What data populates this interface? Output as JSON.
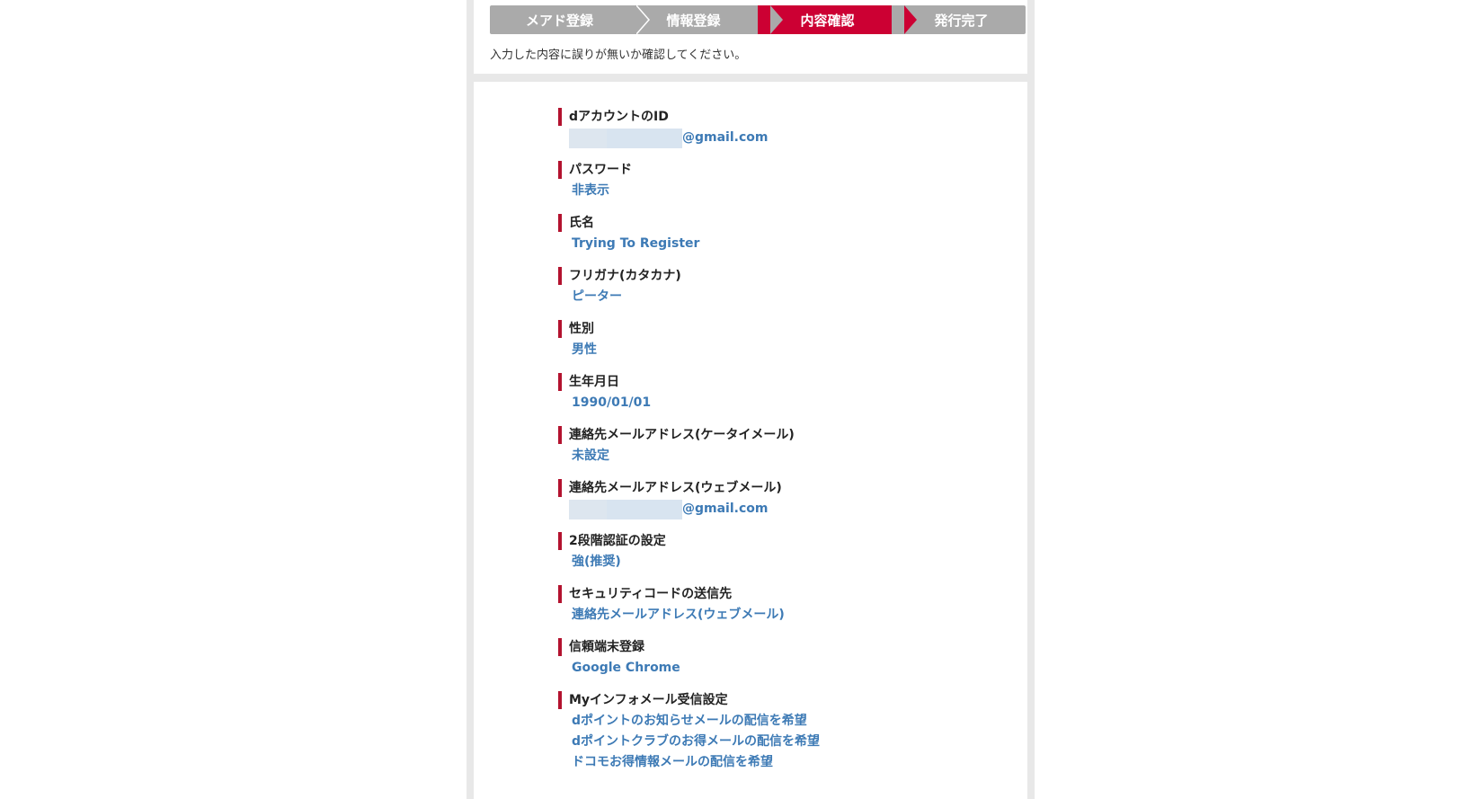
{
  "steps": [
    {
      "label": "メアド登録",
      "state": "done"
    },
    {
      "label": "情報登録",
      "state": "done"
    },
    {
      "label": "内容確認",
      "state": "active"
    },
    {
      "label": "発行完了",
      "state": "pending"
    }
  ],
  "intro_text": "入力した内容に誤りが無いか確認してください。",
  "colors": {
    "step_inactive": "#aaaaaa",
    "step_active": "#cc0033",
    "label_bar": "#b3132f",
    "value_text": "#3d7ab5",
    "mask": "#d8e4f0"
  },
  "items": [
    {
      "label": "dアカウントのID",
      "values": [
        "@gmail.com"
      ],
      "masked": true
    },
    {
      "label": "パスワード",
      "values": [
        "非表示"
      ]
    },
    {
      "label": "氏名",
      "values": [
        "Trying To Register"
      ]
    },
    {
      "label": "フリガナ(カタカナ)",
      "values": [
        "ピーター"
      ]
    },
    {
      "label": "性別",
      "values": [
        "男性"
      ]
    },
    {
      "label": "生年月日",
      "values": [
        "1990/01/01"
      ]
    },
    {
      "label": "連絡先メールアドレス(ケータイメール)",
      "values": [
        "未設定"
      ]
    },
    {
      "label": "連絡先メールアドレス(ウェブメール)",
      "values": [
        "@gmail.com"
      ],
      "masked": true
    },
    {
      "label": "2段階認証の設定",
      "values": [
        "強(推奨)"
      ]
    },
    {
      "label": "セキュリティコードの送信先",
      "values": [
        "連絡先メールアドレス(ウェブメール)"
      ]
    },
    {
      "label": "信頼端末登録",
      "values": [
        "Google Chrome"
      ]
    },
    {
      "label": "Myインフォメール受信設定",
      "values": [
        "dポイントのお知らせメールの配信を希望",
        "dポイントクラブのお得メールの配信を希望",
        "ドコモお得情報メールの配信を希望"
      ]
    }
  ]
}
